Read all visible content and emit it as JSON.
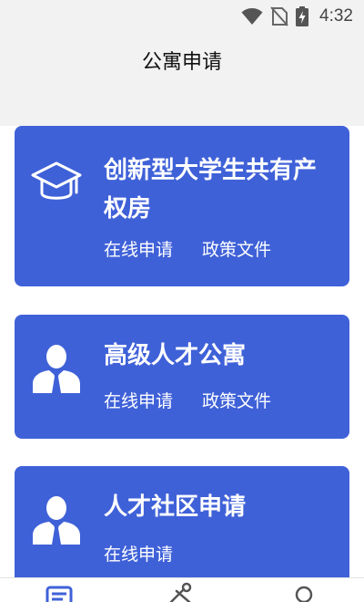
{
  "status_bar": {
    "time": "4:32",
    "icons": [
      "wifi-icon",
      "no-sim-icon",
      "battery-charging-icon"
    ]
  },
  "header": {
    "title": "公寓申请"
  },
  "cards": [
    {
      "icon": "graduation-cap-icon",
      "title": "创新型大学生共有产权房",
      "actions": [
        "在线申请",
        "政策文件"
      ]
    },
    {
      "icon": "person-tie-icon",
      "title": "高级人才公寓",
      "actions": [
        "在线申请",
        "政策文件"
      ]
    },
    {
      "icon": "person-tie-icon",
      "title": "人才社区申请",
      "actions": [
        "在线申请"
      ]
    }
  ],
  "bottom_nav": {
    "items": [
      "list-icon",
      "tools-icon",
      "search-icon"
    ],
    "active_color": "#3f61d8",
    "inactive_color": "#555555"
  },
  "colors": {
    "card_bg": "#3f61d8",
    "header_bg": "#f2f2f2"
  }
}
